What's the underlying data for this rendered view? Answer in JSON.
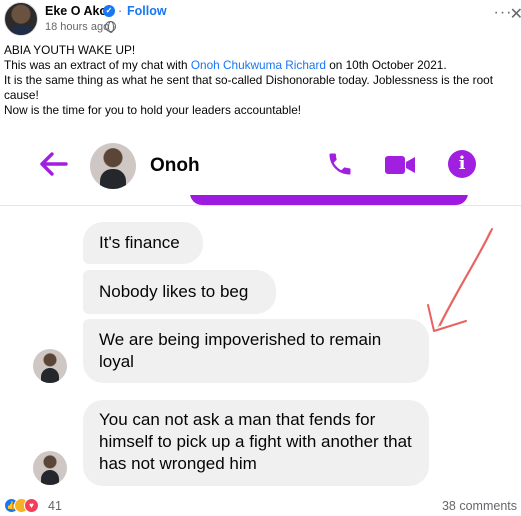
{
  "post": {
    "author": "Eke O Ako",
    "follow_label": "Follow",
    "time": "18 hours ago ·",
    "text_lines": [
      "ABIA YOUTH WAKE UP!",
      "This was an extract of my chat with",
      "Onoh Chukwuma Richard",
      "on 10th October 2021.",
      "It is the same thing as what he sent that so-called Dishonorable today. Joblessness is the root cause!",
      "Now is the time for you to hold your leaders accountable!"
    ]
  },
  "chat": {
    "contact_name": "Onoh",
    "messages": [
      "It's finance",
      "Nobody likes to beg",
      "We are being impoverished to remain loyal",
      "You can not ask a man that fends for himself to pick up a fight with another that has not wronged him"
    ]
  },
  "footer": {
    "reaction_count": "41",
    "comments": "38 comments"
  },
  "colors": {
    "messenger_accent": "#a120e0",
    "link_blue": "#1877f2",
    "bubble_gray": "#f0f0f0",
    "annotation_red": "#e8625f"
  },
  "icons": [
    "verified-icon",
    "globe-icon",
    "more-icon",
    "close-icon",
    "back-arrow-icon",
    "phone-icon",
    "video-icon",
    "info-icon",
    "like-reaction-icon",
    "care-reaction-icon",
    "love-reaction-icon"
  ]
}
